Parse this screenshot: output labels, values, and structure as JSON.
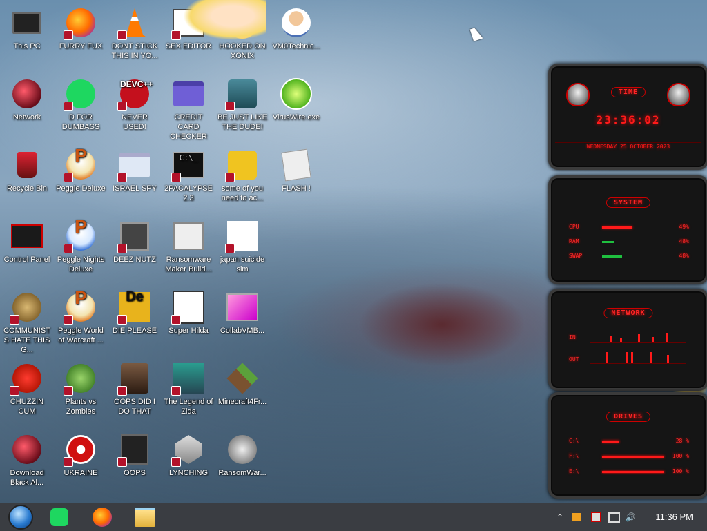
{
  "desktop": {
    "icons": [
      {
        "label": "This PC",
        "icon": "computer-icon"
      },
      {
        "label": "FURRY FUX",
        "icon": "firefox-icon"
      },
      {
        "label": "DONT STICK THIS IN YO...",
        "icon": "vlc-cone-icon"
      },
      {
        "label": "SEX EDITOR",
        "icon": "editor-icon"
      },
      {
        "label": "HOOKED ON XONIX",
        "icon": "star-cartoon-icon"
      },
      {
        "label": "VM0Technic...",
        "icon": "doctor-icon"
      },
      {
        "label": "Network",
        "icon": "network-orb-icon"
      },
      {
        "label": "D FOR DUMBASS",
        "icon": "spotify-icon"
      },
      {
        "label": "NEVER USED!",
        "icon": "dev-cpp-icon"
      },
      {
        "label": "CREDIT CARD CHECKER",
        "icon": "credit-card-icon"
      },
      {
        "label": "BE JUST LIKE THE DUDE!",
        "icon": "santa-icon"
      },
      {
        "label": "VirusWire.exe",
        "icon": "lime-icon"
      },
      {
        "label": "Recycle Bin",
        "icon": "recycle-bin-icon"
      },
      {
        "label": "Peggle Deluxe",
        "icon": "peggle-icon"
      },
      {
        "label": "ISRAEL SPY",
        "icon": "network-spy-icon"
      },
      {
        "label": "2PACALYPSE 2.3",
        "icon": "terminal-icon"
      },
      {
        "label": "some of you need to ac...",
        "icon": "scooby-icon"
      },
      {
        "label": "FLASH !",
        "icon": "flash-icon"
      },
      {
        "label": "Control Panel",
        "icon": "control-panel-icon"
      },
      {
        "label": "Peggle Nights Deluxe",
        "icon": "peggle-nights-icon"
      },
      {
        "label": "DEEZ NUTZ",
        "icon": "windows-stack-icon"
      },
      {
        "label": "Ransomware Maker Build...",
        "icon": "window-app-icon"
      },
      {
        "label": "japan suicide sim",
        "icon": "japan-sim-icon"
      },
      {
        "label": "COMMUNISTS HATE THIS G...",
        "icon": "money-bag-icon"
      },
      {
        "label": "Peggle World of Warcraft ...",
        "icon": "peggle-wow-icon"
      },
      {
        "label": "DIE PLEASE",
        "icon": "die-icon"
      },
      {
        "label": "Super Hilda",
        "icon": "hilda-icon"
      },
      {
        "label": "CollabVMB...",
        "icon": "collab-vm-icon"
      },
      {
        "label": "CHUZZIN CUM",
        "icon": "chuzzle-icon"
      },
      {
        "label": "Plants vs Zombies",
        "icon": "plants-icon"
      },
      {
        "label": "OOPS DID I DO THAT",
        "icon": "portrait-icon"
      },
      {
        "label": "The Legend of Zida",
        "icon": "zelda-icon"
      },
      {
        "label": "Minecraft4Fr...",
        "icon": "minecraft-icon"
      },
      {
        "label": "Download Black Al...",
        "icon": "network-orb-icon"
      },
      {
        "label": "UKRAINE",
        "icon": "radiation-icon"
      },
      {
        "label": "OOPS",
        "icon": "oops-icon"
      },
      {
        "label": "LYNCHING",
        "icon": "lynching-icon"
      },
      {
        "label": "RansomWar...",
        "icon": "skull-icon"
      }
    ]
  },
  "gadgets": {
    "time": {
      "title": "TIME",
      "clock": "23:36:02",
      "date": "WEDNESDAY 25 OCTOBER 2023"
    },
    "system": {
      "title": "SYSTEM",
      "rows": [
        {
          "label": "CPU",
          "value": "49%",
          "level": 0.49,
          "color": "red"
        },
        {
          "label": "RAM",
          "value": "48%",
          "level": 0.2,
          "color": "green"
        },
        {
          "label": "SWAP",
          "value": "48%",
          "level": 0.32,
          "color": "green"
        }
      ]
    },
    "network": {
      "title": "NETWORK",
      "in_label": "IN",
      "out_label": "OUT"
    },
    "drives": {
      "title": "DRIVES",
      "rows": [
        {
          "label": "C:\\",
          "value": "28 %",
          "level": 0.28
        },
        {
          "label": "F:\\",
          "value": "100 %",
          "level": 1.0
        },
        {
          "label": "E:\\",
          "value": "100 %",
          "level": 1.0
        }
      ]
    }
  },
  "taskbar": {
    "start": "start-orb-icon",
    "pinned": [
      "spotify-icon",
      "firefox-icon",
      "file-explorer-icon"
    ],
    "tray": [
      "chevron-up-icon",
      "flag-icon",
      "action-center-icon",
      "network-icon",
      "volume-icon"
    ],
    "time": "11:36 PM"
  }
}
